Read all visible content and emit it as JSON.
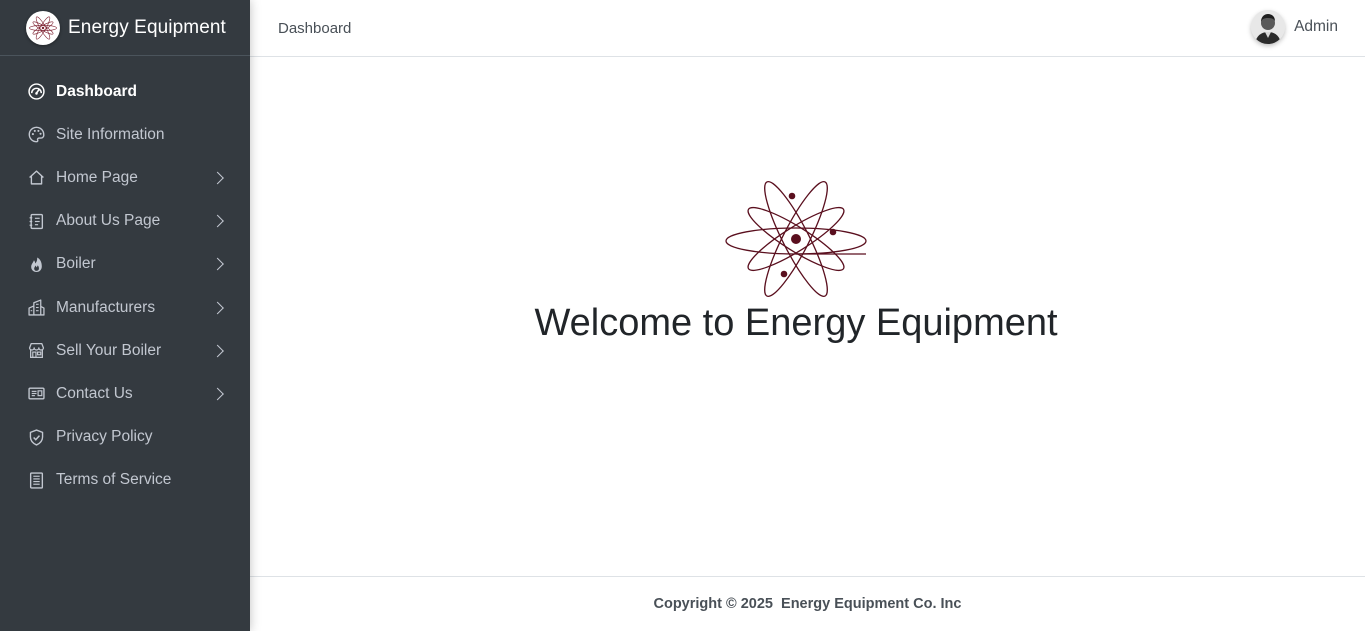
{
  "brand": {
    "name": "Energy Equipment",
    "logo_icon": "atom-logo-icon"
  },
  "topbar": {
    "breadcrumb": "Dashboard",
    "user_name": "Admin",
    "avatar_icon": "user-avatar"
  },
  "sidebar": {
    "items": [
      {
        "label": "Dashboard",
        "icon": "dashboard-gauge-icon",
        "active": true,
        "has_submenu": false
      },
      {
        "label": "Site Information",
        "icon": "palette-icon",
        "active": false,
        "has_submenu": false
      },
      {
        "label": "Home Page",
        "icon": "home-icon",
        "active": false,
        "has_submenu": true
      },
      {
        "label": "About Us Page",
        "icon": "document-icon",
        "active": false,
        "has_submenu": true
      },
      {
        "label": "Boiler",
        "icon": "fire-icon",
        "active": false,
        "has_submenu": true
      },
      {
        "label": "Manufacturers",
        "icon": "buildings-icon",
        "active": false,
        "has_submenu": true
      },
      {
        "label": "Sell Your Boiler",
        "icon": "shop-icon",
        "active": false,
        "has_submenu": true
      },
      {
        "label": "Contact Us",
        "icon": "address-card-icon",
        "active": false,
        "has_submenu": true
      },
      {
        "label": "Privacy Policy",
        "icon": "shield-check-icon",
        "active": false,
        "has_submenu": false
      },
      {
        "label": "Terms of Service",
        "icon": "list-document-icon",
        "active": false,
        "has_submenu": false
      }
    ]
  },
  "main": {
    "welcome_text": "Welcome to Energy Equipment",
    "logo_icon": "atom-logo-icon"
  },
  "footer": {
    "copyright": "Copyright © 2025  Energy Equipment Co. Inc"
  },
  "colors": {
    "sidebar_bg": "#343a40",
    "sidebar_text": "#c2c7d0",
    "active_text": "#ffffff",
    "logo_color": "#5a0f1e",
    "border": "#dee2e6"
  }
}
